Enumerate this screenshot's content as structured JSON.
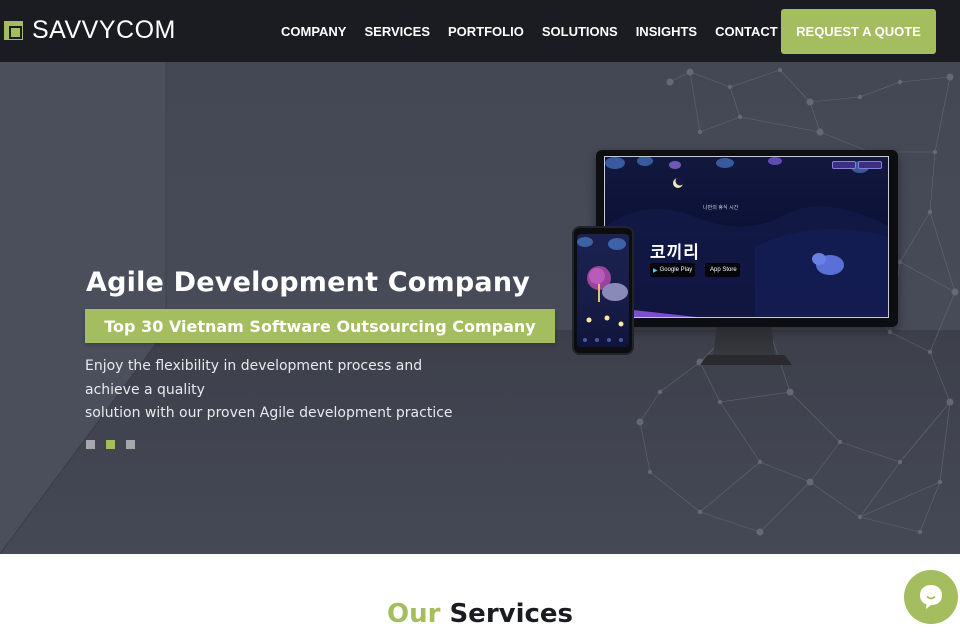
{
  "brand": {
    "name": "SAVVYCOM",
    "accent_color": "#a4bd5e",
    "header_bg": "#1b1c21"
  },
  "nav": {
    "items": [
      {
        "label": "COMPANY"
      },
      {
        "label": "SERVICES"
      },
      {
        "label": "PORTFOLIO"
      },
      {
        "label": "SOLUTIONS"
      },
      {
        "label": "INSIGHTS"
      },
      {
        "label": "CONTACT"
      }
    ],
    "cta_label": "REQUEST A QUOTE"
  },
  "hero": {
    "title": "Agile Development Company",
    "badge": "Top 30 Vietnam Software Outsourcing Company",
    "description_lines": [
      "Enjoy the flexibility in development process and",
      "achieve a quality",
      "solution with our proven Agile development practice"
    ],
    "slider": {
      "total_slides": 3,
      "active_slide": 2
    },
    "mockup": {
      "app_name": "코끼리",
      "tagline": "나만의 휴식 시간",
      "store_badges": [
        "Google Play",
        "App Store"
      ]
    }
  },
  "services": {
    "title_accent": "Our",
    "title_rest": " Services"
  },
  "chat_widget": {
    "icon": "chat-bubble-icon"
  }
}
